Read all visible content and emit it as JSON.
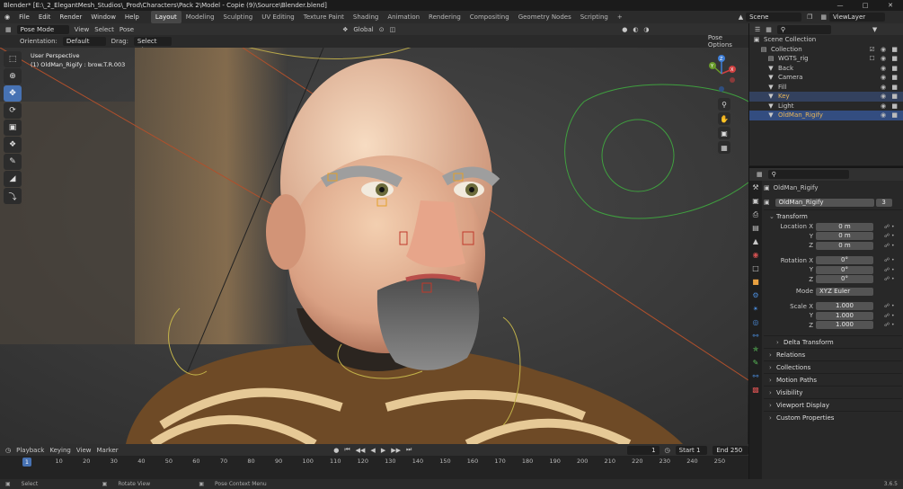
{
  "titlebar": {
    "title": "Blender* [E:\\_2_ElegantMesh_Studios\\_Prod\\Characters\\Pack 2\\Model - Copie (9)\\Source\\Blender.blend]"
  },
  "menu": [
    "File",
    "Edit",
    "Render",
    "Window",
    "Help"
  ],
  "workspaces": [
    "Layout",
    "Modeling",
    "Sculpting",
    "UV Editing",
    "Texture Paint",
    "Shading",
    "Animation",
    "Rendering",
    "Compositing",
    "Geometry Nodes",
    "Scripting",
    "+"
  ],
  "scene": "Scene",
  "view_layer": "ViewLayer",
  "viewport_header": {
    "mode": "Pose Mode",
    "view": "View",
    "select": "Select",
    "pose": "Pose",
    "transform": "Global",
    "pose_options": "Pose Options"
  },
  "tool_header": {
    "orientation_label": "Orientation:",
    "orientation_value": "Default",
    "drag_label": "Drag:",
    "drag_value": "Select Cir..."
  },
  "viewport_info": {
    "perspective": "User Perspective",
    "object": "(1) OldMan_Rigify : brow.T.R.003"
  },
  "gizmo": {
    "x": "X",
    "y": "Y",
    "z": "Z"
  },
  "outliner": {
    "rows": [
      {
        "label": "Scene Collection",
        "indent": 0,
        "icon": "▣",
        "vis": ""
      },
      {
        "label": "Collection",
        "indent": 1,
        "icon": "▤",
        "vis": "☑ ◉ ■"
      },
      {
        "label": "WGTS_rig",
        "indent": 2,
        "icon": "▤",
        "vis": "☐ ◉ ■"
      },
      {
        "label": "Back",
        "indent": 2,
        "icon": "▼",
        "vis": "◉ ■"
      },
      {
        "label": "Camera",
        "indent": 2,
        "icon": "▼",
        "vis": "◉ ■"
      },
      {
        "label": "Fill",
        "indent": 2,
        "icon": "▼",
        "vis": "◉ ■"
      },
      {
        "label": "Key",
        "indent": 2,
        "icon": "▼",
        "vis": "◉ ■"
      },
      {
        "label": "Light",
        "indent": 2,
        "icon": "▼",
        "vis": "◉ ■"
      },
      {
        "label": "OldMan_Rigify",
        "indent": 2,
        "icon": "▼",
        "vis": "◉ ■"
      }
    ]
  },
  "properties": {
    "object_name": "OldMan_Rigify",
    "data_name": "OldMan_Rigify",
    "users": "3",
    "transform": "Transform",
    "location": {
      "label": "Location X",
      "x": "0 m",
      "y": "0 m",
      "z": "0 m"
    },
    "rotation": {
      "label": "Rotation X",
      "x": "0°",
      "y": "0°",
      "z": "0°"
    },
    "mode": {
      "label": "Mode",
      "value": "XYZ Euler"
    },
    "scale": {
      "label": "Scale X",
      "x": "1.000",
      "y": "1.000",
      "z": "1.000"
    },
    "axis_y": "Y",
    "axis_z": "Z",
    "sections": [
      "Delta Transform",
      "Relations",
      "Collections",
      "Motion Paths",
      "Visibility",
      "Viewport Display",
      "Custom Properties"
    ]
  },
  "timeline": {
    "playback": "Playback",
    "keying": "Keying",
    "view": "View",
    "marker": "Marker",
    "current_frame": "1",
    "start_label": "Start",
    "start": "1",
    "end_label": "End",
    "end": "250",
    "ticks": [
      "1",
      "10",
      "20",
      "30",
      "40",
      "50",
      "60",
      "70",
      "80",
      "90",
      "100",
      "110",
      "120",
      "130",
      "140",
      "150",
      "160",
      "170",
      "180",
      "190",
      "200",
      "210",
      "220",
      "230",
      "240",
      "250"
    ]
  },
  "status": {
    "select": "Select",
    "rotate": "Rotate View",
    "context": "Pose Context Menu",
    "version": "3.6.5"
  },
  "colors": {
    "accent": "#4772b3",
    "selection": "#334d80",
    "key_light": "#e8b65a"
  }
}
